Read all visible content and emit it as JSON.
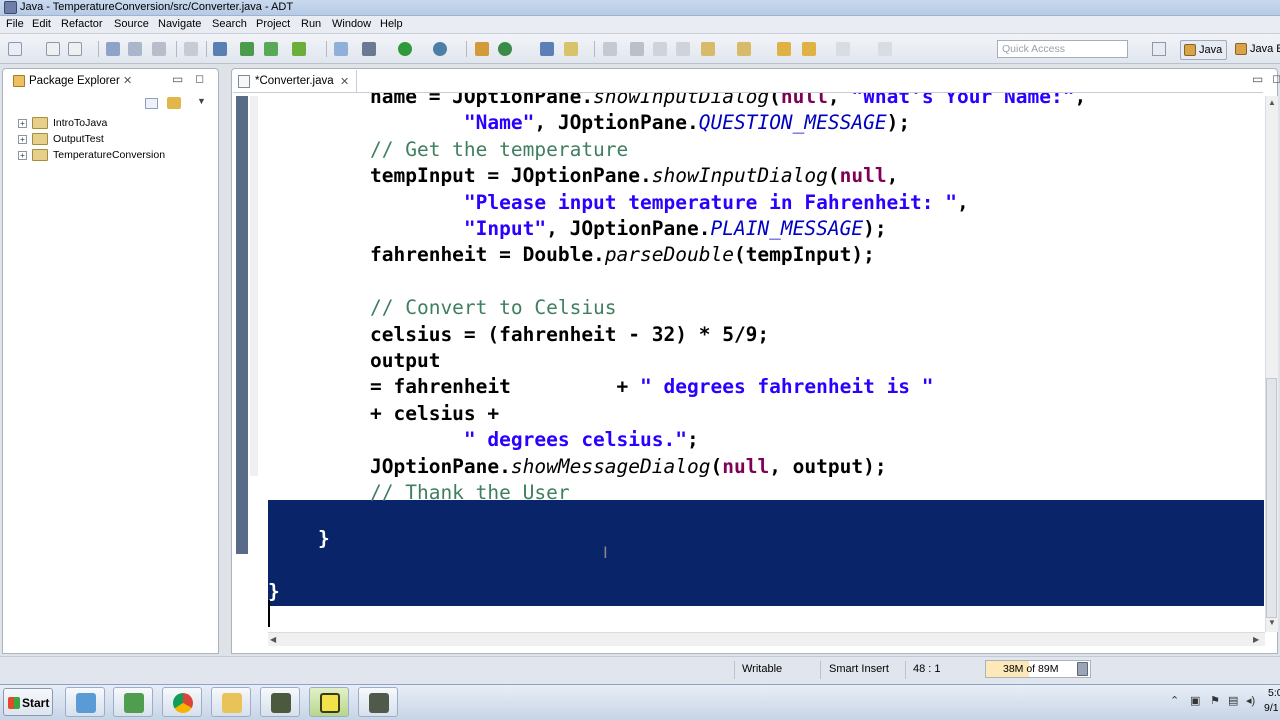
{
  "window": {
    "title": "Java - TemperatureConversion/src/Converter.java - ADT"
  },
  "menubar": {
    "items": [
      "File",
      "Edit",
      "Refactor",
      "Source",
      "Navigate",
      "Search",
      "Project",
      "Run",
      "Window",
      "Help"
    ]
  },
  "toolbar": {
    "quick_access_placeholder": "Quick Access",
    "perspectives": [
      "Java",
      "Java E"
    ]
  },
  "package_explorer": {
    "title": "Package Explorer",
    "projects": [
      {
        "label": "IntroToJava",
        "expander": "+"
      },
      {
        "label": "OutputTest",
        "expander": "+"
      },
      {
        "label": "TemperatureConversion",
        "expander": "+"
      }
    ]
  },
  "editor": {
    "tab_label": "*Converter.java",
    "code_lines": [
      {
        "parts": [
          {
            "t": "name = JOptionPane.",
            "c": "k"
          },
          {
            "t": "showInputDialog",
            "c": "it"
          },
          {
            "t": "(",
            "c": "k"
          },
          {
            "t": "null",
            "c": "kw"
          },
          {
            "t": ", ",
            "c": "k"
          },
          {
            "t": "\"What's Your Name:\"",
            "c": "str"
          },
          {
            "t": ",",
            "c": "k"
          }
        ]
      },
      {
        "parts": [
          {
            "t": "        \"Name\"",
            "c": "str"
          },
          {
            "t": ", JOptionPane.",
            "c": "k"
          },
          {
            "t": "QUESTION_MESSAGE",
            "c": "itc"
          },
          {
            "t": ");",
            "c": "k"
          }
        ]
      },
      {
        "parts": [
          {
            "t": "// Get the temperature",
            "c": "cm"
          }
        ]
      },
      {
        "parts": [
          {
            "t": "tempInput = JOptionPane.",
            "c": "k"
          },
          {
            "t": "showInputDialog",
            "c": "it"
          },
          {
            "t": "(",
            "c": "k"
          },
          {
            "t": "null",
            "c": "kw"
          },
          {
            "t": ",",
            "c": "k"
          }
        ]
      },
      {
        "parts": [
          {
            "t": "        \"Please input temperature in Fahrenheit: \"",
            "c": "str"
          },
          {
            "t": ",",
            "c": "k"
          }
        ]
      },
      {
        "parts": [
          {
            "t": "        \"Input\"",
            "c": "str"
          },
          {
            "t": ", JOptionPane.",
            "c": "k"
          },
          {
            "t": "PLAIN_MESSAGE",
            "c": "itc"
          },
          {
            "t": ");",
            "c": "k"
          }
        ]
      },
      {
        "parts": [
          {
            "t": "fahrenheit = Double.",
            "c": "k"
          },
          {
            "t": "parseDouble",
            "c": "it"
          },
          {
            "t": "(tempInput);",
            "c": "k"
          }
        ]
      },
      {
        "parts": [
          {
            "t": "",
            "c": "k"
          }
        ]
      },
      {
        "parts": [
          {
            "t": "// Convert to Celsius",
            "c": "cm"
          }
        ]
      },
      {
        "parts": [
          {
            "t": "celsius = (fahrenheit - 32) * 5/9;",
            "c": "k"
          }
        ]
      },
      {
        "parts": [
          {
            "t": "output",
            "c": "k"
          }
        ]
      },
      {
        "parts": [
          {
            "t": "= fahrenheit         + ",
            "c": "k"
          },
          {
            "t": "\" degrees fahrenheit is \"",
            "c": "str"
          }
        ]
      },
      {
        "parts": [
          {
            "t": "+ celsius +",
            "c": "k"
          }
        ]
      },
      {
        "parts": [
          {
            "t": "        \" degrees celsius.\"",
            "c": "str"
          },
          {
            "t": ";",
            "c": "k"
          }
        ]
      },
      {
        "parts": [
          {
            "t": "JOptionPane.",
            "c": "k"
          },
          {
            "t": "showMessageDialog",
            "c": "it"
          },
          {
            "t": "(",
            "c": "k"
          },
          {
            "t": "null",
            "c": "kw"
          },
          {
            "t": ", output);",
            "c": "k"
          }
        ]
      },
      {
        "parts": [
          {
            "t": "// Thank the User",
            "c": "cm"
          }
        ]
      }
    ],
    "closing_brace_inner": "}",
    "closing_brace_outer": "}"
  },
  "statusbar": {
    "mode": "Writable",
    "insert": "Smart Insert",
    "position": "48 : 1",
    "heap": "38M of 89M",
    "heap_used_fraction": 0.43
  },
  "taskbar": {
    "start_label": "Start",
    "clock_time": "5:0",
    "clock_date": "9/1"
  },
  "colors": {
    "selection": "#0a246a",
    "keyword": "#7f0055",
    "string": "#2a00ff",
    "comment": "#3f7f5f",
    "constant": "#0000c0"
  }
}
